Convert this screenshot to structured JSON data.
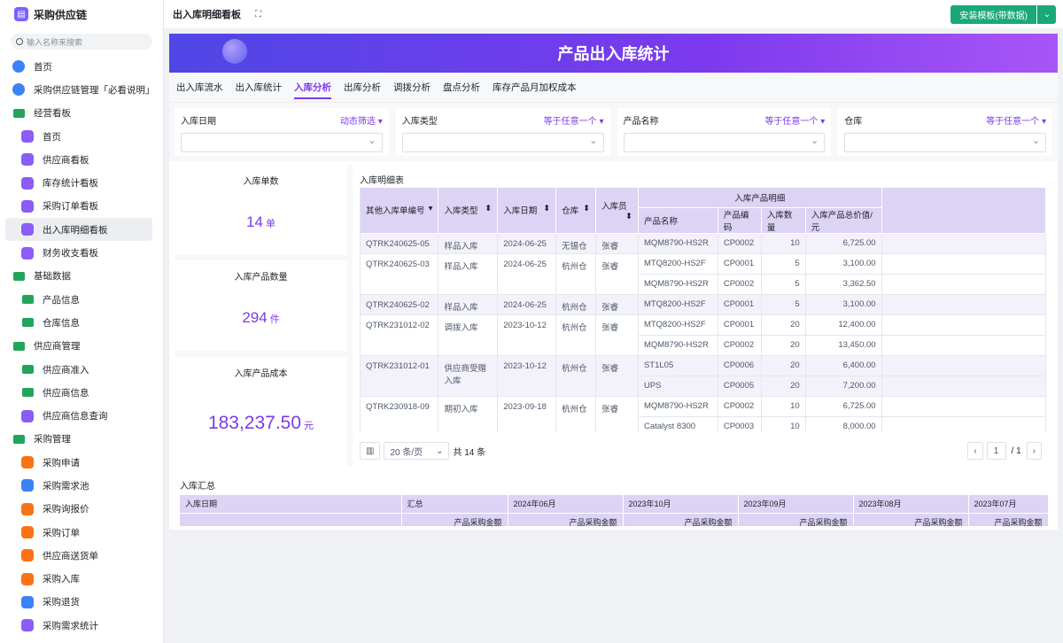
{
  "sidebar": {
    "brand": "采购供应链",
    "search_placeholder": "输入名称来搜索",
    "items": [
      {
        "label": "首页",
        "icon": "home-icon",
        "level": 0,
        "kind": "blue"
      },
      {
        "label": "采购供应链管理「必看说明」",
        "icon": "doc-icon",
        "level": 0,
        "kind": "blue"
      },
      {
        "label": "经营看板",
        "icon": "folder-icon",
        "level": 0,
        "kind": "folder"
      },
      {
        "label": "首页",
        "icon": "dashboard-icon",
        "level": 1,
        "kind": "purple"
      },
      {
        "label": "供应商看板",
        "icon": "dashboard-icon",
        "level": 1,
        "kind": "purple"
      },
      {
        "label": "库存统计看板",
        "icon": "dashboard-icon",
        "level": 1,
        "kind": "purple"
      },
      {
        "label": "采购订单看板",
        "icon": "dashboard-icon",
        "level": 1,
        "kind": "purple"
      },
      {
        "label": "出入库明细看板",
        "icon": "dashboard-icon",
        "level": 1,
        "kind": "purple",
        "active": true
      },
      {
        "label": "财务收支看板",
        "icon": "dashboard-icon",
        "level": 1,
        "kind": "purple"
      },
      {
        "label": "基础数据",
        "icon": "folder-icon",
        "level": 0,
        "kind": "folder"
      },
      {
        "label": "产品信息",
        "icon": "folder-icon",
        "level": 1,
        "kind": "folder"
      },
      {
        "label": "仓库信息",
        "icon": "folder-icon",
        "level": 1,
        "kind": "folder"
      },
      {
        "label": "供应商管理",
        "icon": "folder-icon",
        "level": 0,
        "kind": "folder"
      },
      {
        "label": "供应商准入",
        "icon": "folder-icon",
        "level": 1,
        "kind": "folder"
      },
      {
        "label": "供应商信息",
        "icon": "folder-icon",
        "level": 1,
        "kind": "folder"
      },
      {
        "label": "供应商信息查询",
        "icon": "dashboard-icon",
        "level": 1,
        "kind": "purple"
      },
      {
        "label": "采购管理",
        "icon": "folder-icon",
        "level": 0,
        "kind": "folder"
      },
      {
        "label": "采购申请",
        "icon": "form-icon",
        "level": 1,
        "kind": "orange"
      },
      {
        "label": "采购需求池",
        "icon": "table-icon",
        "level": 1,
        "kind": "blue"
      },
      {
        "label": "采购询报价",
        "icon": "form-icon",
        "level": 1,
        "kind": "orange"
      },
      {
        "label": "采购订单",
        "icon": "form-icon",
        "level": 1,
        "kind": "orange"
      },
      {
        "label": "供应商送货单",
        "icon": "form-icon",
        "level": 1,
        "kind": "orange"
      },
      {
        "label": "采购入库",
        "icon": "form-icon",
        "level": 1,
        "kind": "orange"
      },
      {
        "label": "采购退货",
        "icon": "table-icon",
        "level": 1,
        "kind": "blue"
      },
      {
        "label": "采购需求统计",
        "icon": "chart-icon",
        "level": 1,
        "kind": "purple"
      }
    ]
  },
  "topbar": {
    "title": "出入库明细看板",
    "install_button": "安装模板(带数据)"
  },
  "banner": {
    "title": "产品出入库统计"
  },
  "tabs": [
    "出入库流水",
    "出入库统计",
    "入库分析",
    "出库分析",
    "调拨分析",
    "盘点分析",
    "库存产品月加权成本"
  ],
  "active_tab": 2,
  "filters": [
    {
      "label": "入库日期",
      "op": "动态筛选 ▾"
    },
    {
      "label": "入库类型",
      "op": "等于任意一个 ▾"
    },
    {
      "label": "产品名称",
      "op": "等于任意一个 ▾"
    },
    {
      "label": "仓库",
      "op": "等于任意一个 ▾"
    }
  ],
  "stats": [
    {
      "label": "入库单数",
      "value": "14",
      "unit": "单"
    },
    {
      "label": "入库产品数量",
      "value": "294",
      "unit": "件"
    },
    {
      "label": "入库产品成本",
      "value": "183,237.50",
      "unit": "元"
    }
  ],
  "detail": {
    "title": "入库明细表",
    "group_header": "入库产品明细",
    "headers": [
      "其他入库单编号",
      "入库类型",
      "入库日期",
      "仓库",
      "入库员"
    ],
    "sub_headers": [
      "产品名称",
      "产品编码",
      "入库数量",
      "入库产品总价值/元"
    ],
    "rows": [
      {
        "no": "QTRK240625-05",
        "type": "样品入库",
        "date": "2024-06-25",
        "wh": "无锡仓",
        "op": "张睿",
        "items": [
          [
            "MQM8790-HS2R",
            "CP0002",
            "10",
            "6,725.00"
          ]
        ]
      },
      {
        "no": "QTRK240625-03",
        "type": "样品入库",
        "date": "2024-06-25",
        "wh": "杭州仓",
        "op": "张睿",
        "items": [
          [
            "MTQ8200-HS2F",
            "CP0001",
            "5",
            "3,100.00"
          ],
          [
            "MQM8790-HS2R",
            "CP0002",
            "5",
            "3,362.50"
          ]
        ]
      },
      {
        "no": "QTRK240625-02",
        "type": "样品入库",
        "date": "2024-06-25",
        "wh": "杭州仓",
        "op": "张睿",
        "items": [
          [
            "MTQ8200-HS2F",
            "CP0001",
            "5",
            "3,100.00"
          ]
        ]
      },
      {
        "no": "QTRK231012-02",
        "type": "调拨入库",
        "date": "2023-10-12",
        "wh": "杭州仓",
        "op": "张睿",
        "items": [
          [
            "MTQ8200-HS2F",
            "CP0001",
            "20",
            "12,400.00"
          ],
          [
            "MQM8790-HS2R",
            "CP0002",
            "20",
            "13,450.00"
          ]
        ]
      },
      {
        "no": "QTRK231012-01",
        "type": "供应商受赠入库",
        "date": "2023-10-12",
        "wh": "杭州仓",
        "op": "张睿",
        "items": [
          [
            "ST1L05",
            "CP0006",
            "20",
            "6,400.00"
          ],
          [
            "UPS",
            "CP0005",
            "20",
            "7,200.00"
          ]
        ]
      },
      {
        "no": "QTRK230918-09",
        "type": "期初入库",
        "date": "2023-09-18",
        "wh": "杭州仓",
        "op": "张睿",
        "items": [
          [
            "MQM8790-HS2R",
            "CP0002",
            "10",
            "6,725.00"
          ],
          [
            "Catalyst 8300",
            "CP0003",
            "10",
            "8,000.00"
          ]
        ]
      }
    ],
    "page_size": "20 条/页",
    "total": "共 14 条",
    "page": "1",
    "pages": "/ 1"
  },
  "summary": {
    "title": "入库汇总",
    "headers": [
      "入库日期",
      "汇总",
      "2024年06月",
      "2023年10月",
      "2023年09月",
      "2023年08月",
      "2023年07月"
    ],
    "sub_label": "产品采购金额"
  }
}
